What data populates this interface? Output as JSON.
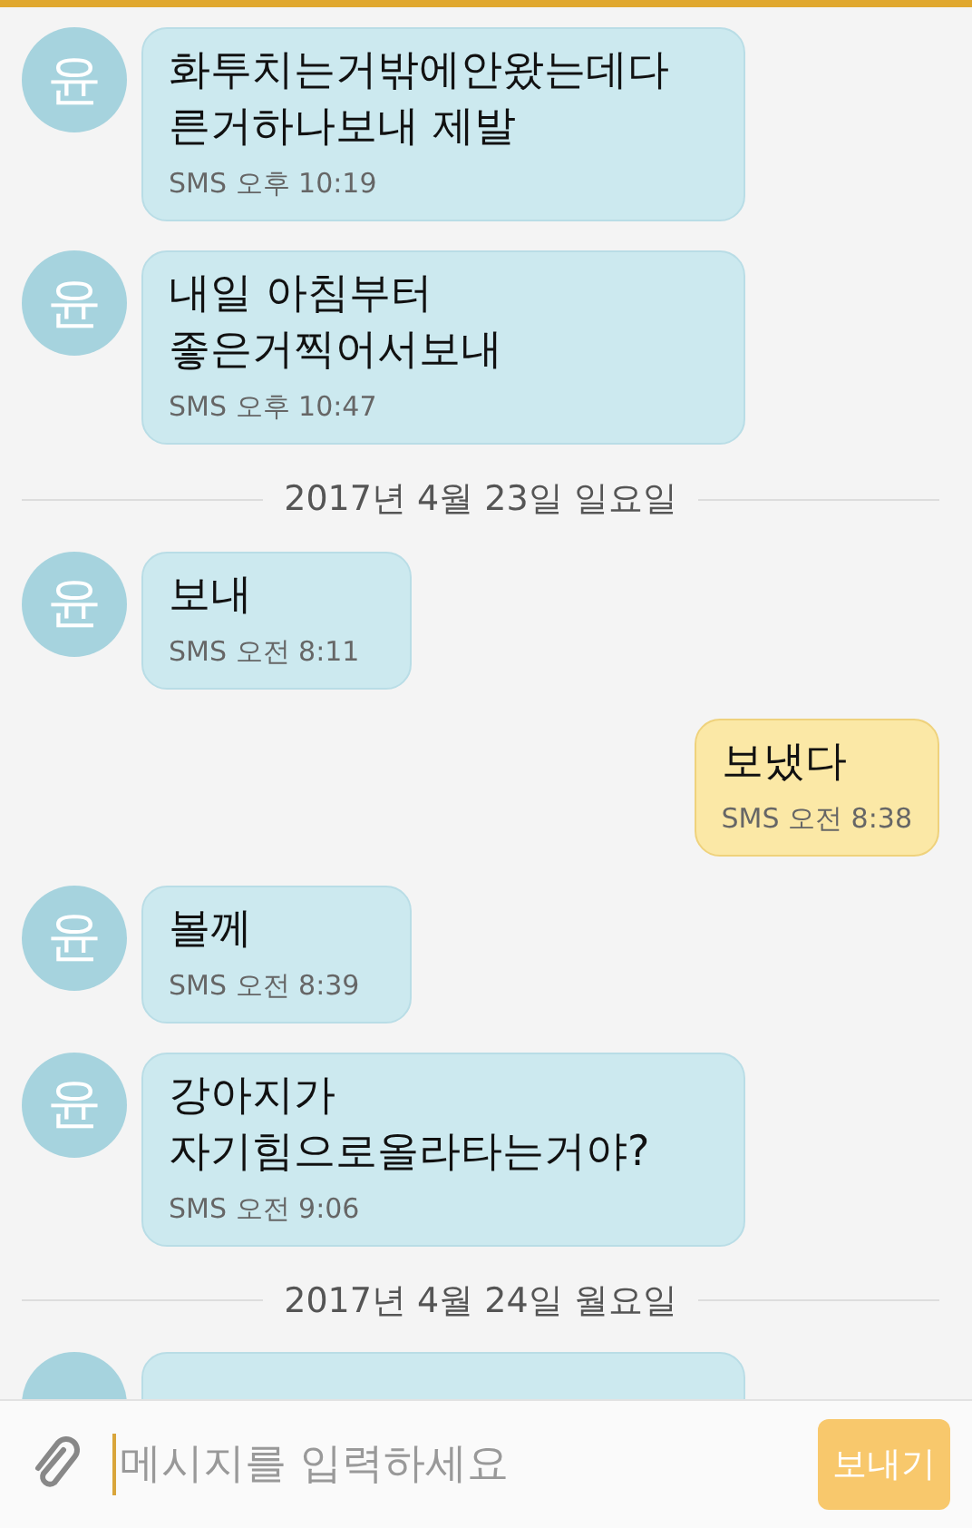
{
  "messages": [
    {
      "kind": "incoming",
      "avatar": "윤",
      "lines": [
        "화투치는거밖에안왔는데다",
        "른거하나보내 제발"
      ],
      "meta": "SMS 오후 10:19"
    },
    {
      "kind": "incoming",
      "avatar": "윤",
      "lines": [
        "내일 아침부터",
        "좋은거찍어서보내"
      ],
      "meta": "SMS 오후 10:47"
    },
    {
      "kind": "date",
      "text": "2017년 4월 23일 일요일"
    },
    {
      "kind": "incoming",
      "avatar": "윤",
      "lines": [
        "보내"
      ],
      "meta": "SMS 오전 8:11"
    },
    {
      "kind": "outgoing",
      "lines": [
        "보냈다"
      ],
      "meta": "SMS 오전 8:38"
    },
    {
      "kind": "incoming",
      "avatar": "윤",
      "lines": [
        "볼께"
      ],
      "meta": "SMS 오전 8:39"
    },
    {
      "kind": "incoming",
      "avatar": "윤",
      "lines": [
        "강아지가",
        "자기힘으로올라타는거야?"
      ],
      "meta": "SMS 오전 9:06"
    },
    {
      "kind": "date",
      "text": "2017년 4월 24일 월요일"
    },
    {
      "kind": "incoming_cut"
    }
  ],
  "composer": {
    "placeholder": "메시지를 입력하세요",
    "focused": true,
    "send": "보내기"
  }
}
